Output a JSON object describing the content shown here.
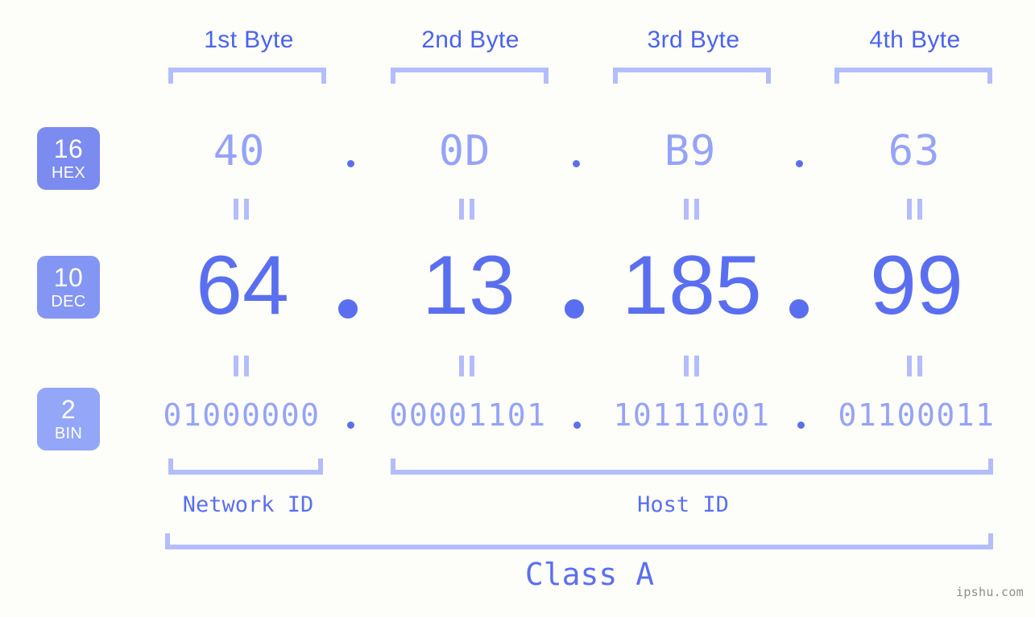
{
  "watermark": "ipshu.com",
  "byte_headers": [
    {
      "label": "1st Byte"
    },
    {
      "label": "2nd Byte"
    },
    {
      "label": "3rd Byte"
    },
    {
      "label": "4th Byte"
    }
  ],
  "radix_badges": [
    {
      "num": "16",
      "name": "HEX",
      "color": "#7b8bf0"
    },
    {
      "num": "10",
      "name": "DEC",
      "color": "#8496f3"
    },
    {
      "num": "2",
      "name": "BIN",
      "color": "#93a6f8"
    }
  ],
  "rows": {
    "hex": {
      "values": [
        "40",
        "0D",
        "B9",
        "63"
      ],
      "separator": "."
    },
    "dec": {
      "values": [
        "64",
        "13",
        "185",
        "99"
      ],
      "separator": "."
    },
    "bin": {
      "values": [
        "01000000",
        "00001101",
        "10111001",
        "01100011"
      ],
      "separator": "."
    }
  },
  "equals_marks": {
    "glyph": "||",
    "count": 8
  },
  "segments": {
    "network_id": "Network ID",
    "host_id": "Host ID",
    "class": "Class A"
  },
  "colors": {
    "background": "#fdfefa",
    "accent_strong": "#5a6ff0",
    "accent_header": "#4a63ef",
    "accent_light": "#95a3f7",
    "bracket": "#b3bdfb",
    "watermark": "#8d8d8d"
  }
}
